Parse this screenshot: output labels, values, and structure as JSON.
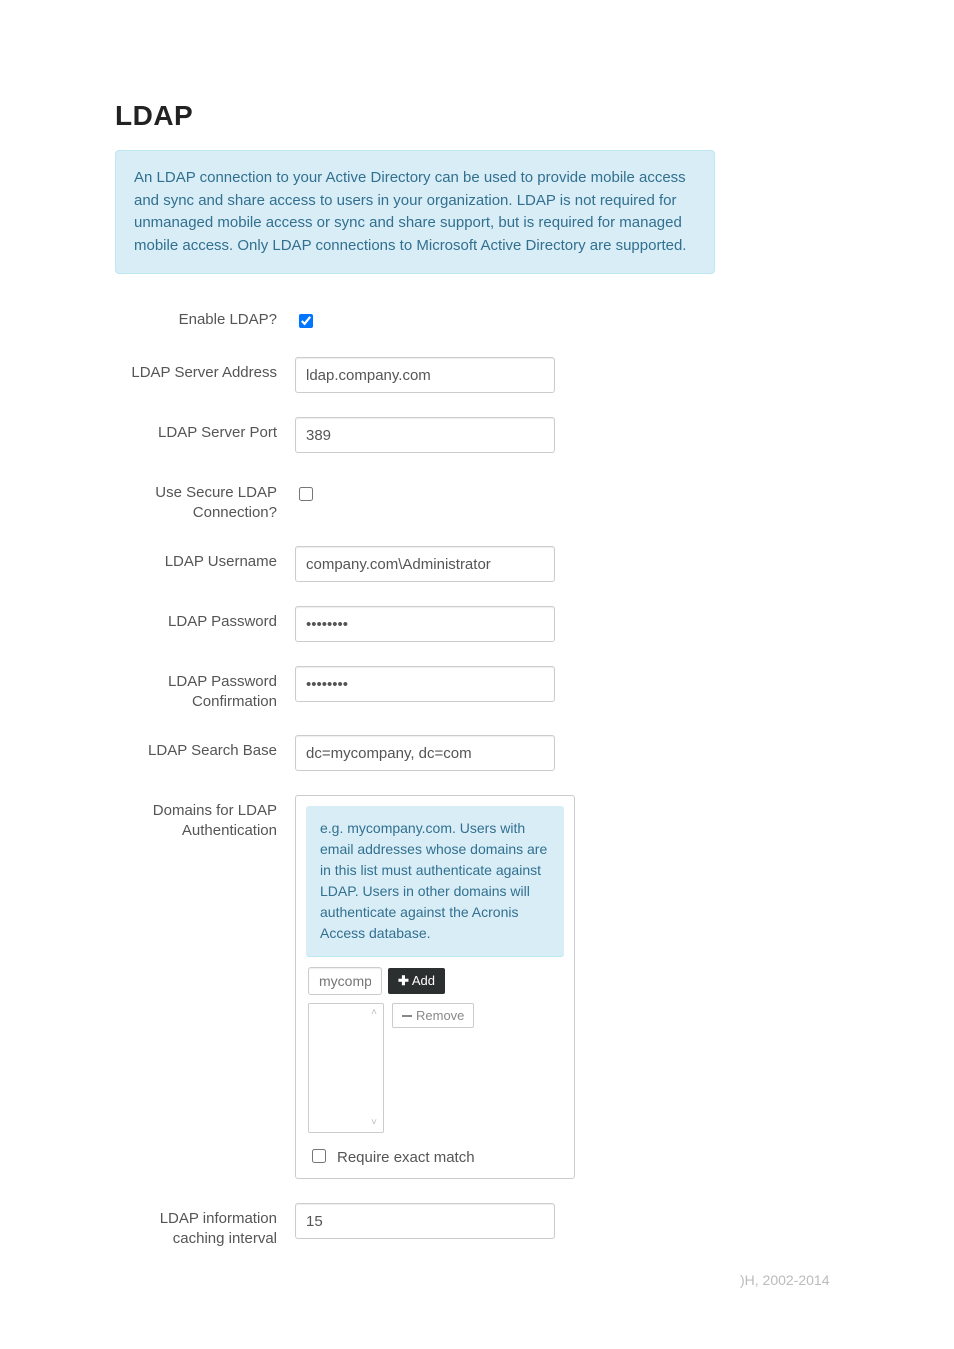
{
  "title": "LDAP",
  "info_text": "An LDAP connection to your Active Directory can be used to provide mobile access and sync and share access to users in your organization. LDAP is not required for unmanaged mobile access or sync and share support, but is required for managed mobile access. Only LDAP connections to Microsoft Active Directory are supported.",
  "form": {
    "enable_ldap": {
      "label": "Enable LDAP?",
      "checked": true
    },
    "server_address": {
      "label": "LDAP Server Address",
      "value": "ldap.company.com"
    },
    "server_port": {
      "label": "LDAP Server Port",
      "value": "389"
    },
    "secure_conn": {
      "label": "Use Secure LDAP Connection?",
      "checked": false
    },
    "username": {
      "label": "LDAP Username",
      "value": "company.com\\Administrator"
    },
    "password": {
      "label": "LDAP Password",
      "value": "••••••••"
    },
    "password_confirm": {
      "label": "LDAP Password Confirmation",
      "value": "••••••••"
    },
    "search_base": {
      "label": "LDAP Search Base",
      "value": "dc=mycompany, dc=com"
    },
    "domains": {
      "label": "Domains for LDAP Authentication",
      "help": "e.g. mycompany.com. Users with email addresses whose domains are in this list must authenticate against LDAP. Users in other domains will authenticate against the Acronis Access database.",
      "add_placeholder": "mycompa",
      "add_button": "Add",
      "remove_button": "Remove",
      "exact_match_label": "Require exact match",
      "exact_match_checked": false,
      "list_items": []
    },
    "caching_interval": {
      "label": "LDAP information caching interval",
      "value": "15"
    }
  },
  "footer_fragment": ")H, 2002-2014"
}
